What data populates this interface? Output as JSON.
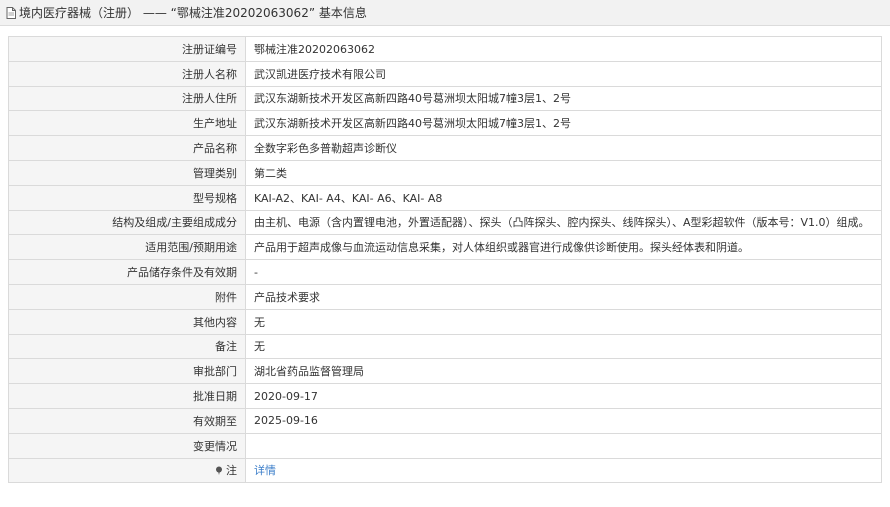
{
  "header": {
    "icon": "document-icon",
    "title": "境内医疗器械（注册） —— “鄂械注准20202063062” 基本信息"
  },
  "rows": [
    {
      "label": "注册证编号",
      "value": "鄂械注准20202063062"
    },
    {
      "label": "注册人名称",
      "value": "武汉凯进医疗技术有限公司"
    },
    {
      "label": "注册人住所",
      "value": "武汉东湖新技术开发区高新四路40号葛洲坝太阳城7幢3层1、2号"
    },
    {
      "label": "生产地址",
      "value": "武汉东湖新技术开发区高新四路40号葛洲坝太阳城7幢3层1、2号"
    },
    {
      "label": "产品名称",
      "value": "全数字彩色多普勒超声诊断仪"
    },
    {
      "label": "管理类别",
      "value": "第二类"
    },
    {
      "label": "型号规格",
      "value": "KAI-A2、KAI- A4、KAI- A6、KAI- A8"
    },
    {
      "label": "结构及组成/主要组成成分",
      "value": "由主机、电源（含内置锂电池，外置适配器）、探头（凸阵探头、腔内探头、线阵探头）、A型彩超软件（版本号：V1.0）组成。"
    },
    {
      "label": "适用范围/预期用途",
      "value": "产品用于超声成像与血流运动信息采集，对人体组织或器官进行成像供诊断使用。探头经体表和阴道。"
    },
    {
      "label": "产品储存条件及有效期",
      "value": "-"
    },
    {
      "label": "附件",
      "value": "产品技术要求"
    },
    {
      "label": "其他内容",
      "value": "无"
    },
    {
      "label": "备注",
      "value": "无"
    },
    {
      "label": "审批部门",
      "value": "湖北省药品监督管理局"
    },
    {
      "label": "批准日期",
      "value": "2020-09-17"
    },
    {
      "label": "有效期至",
      "value": "2025-09-16"
    },
    {
      "label": "变更情况",
      "value": ""
    }
  ],
  "note_row": {
    "pin_icon": "pin-icon",
    "label": "注",
    "link_text": "详情"
  },
  "colors": {
    "label_bg": "#f5f5f5",
    "border": "#dadada",
    "link": "#3a7dc9"
  }
}
